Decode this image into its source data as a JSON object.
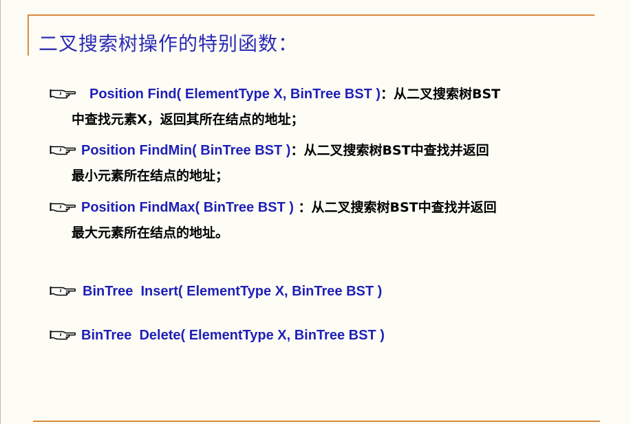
{
  "title": "二叉搜索树操作的特别函数：",
  "icon": "pointing-hand-icon",
  "accent_color": "#d9893a",
  "code_color": "#1f1fb8",
  "items": [
    {
      "code": "Position Find( ElementType X, BinTree BST )",
      "desc1": "：从二叉搜索树BST",
      "desc2": "中查找元素X，返回其所在结点的地址；"
    },
    {
      "code": "Position FindMin( BinTree BST )",
      "desc1": "：从二叉搜索树BST中查找并返回",
      "desc2": "最小元素所在结点的地址；"
    },
    {
      "code": "Position FindMax( BinTree BST )",
      "desc1": " ：从二叉搜索树BST中查找并返回",
      "desc2": "最大元素所在结点的地址。"
    },
    {
      "code": "BinTree  Insert( ElementType X, BinTree BST )"
    },
    {
      "code": "BinTree  Delete( ElementType X, BinTree BST )"
    }
  ]
}
